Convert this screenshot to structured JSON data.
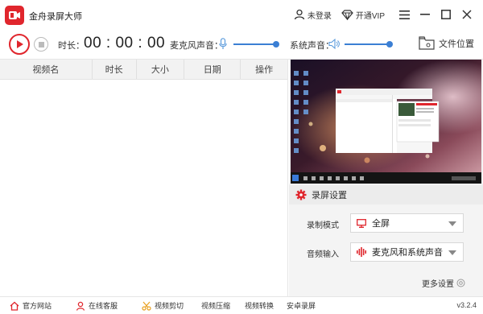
{
  "app": {
    "title": "金舟录屏大师"
  },
  "titlebar": {
    "login": "未登录",
    "vip": "开通VIP"
  },
  "controls": {
    "duration_label": "时长：",
    "duration_value": "00 : 00 : 00",
    "mic_label": "麦克风声音：",
    "sys_label": "系统声音：",
    "file_location": "文件位置"
  },
  "list": {
    "columns": [
      "视频名",
      "时长",
      "大小",
      "日期",
      "操作"
    ]
  },
  "settings": {
    "header": "录屏设置",
    "mode_label": "录制模式",
    "mode_value": "全屏",
    "audio_label": "音频输入",
    "audio_value": "麦克风和系统声音",
    "more": "更多设置"
  },
  "bottom": {
    "items": [
      "官方网站",
      "在线客服",
      "视频剪切",
      "视频压缩",
      "视频转换",
      "安卓录屏"
    ],
    "version": "v3.2.4"
  },
  "colors": {
    "accent": "#e0262d",
    "slider": "#3b7fd4"
  }
}
